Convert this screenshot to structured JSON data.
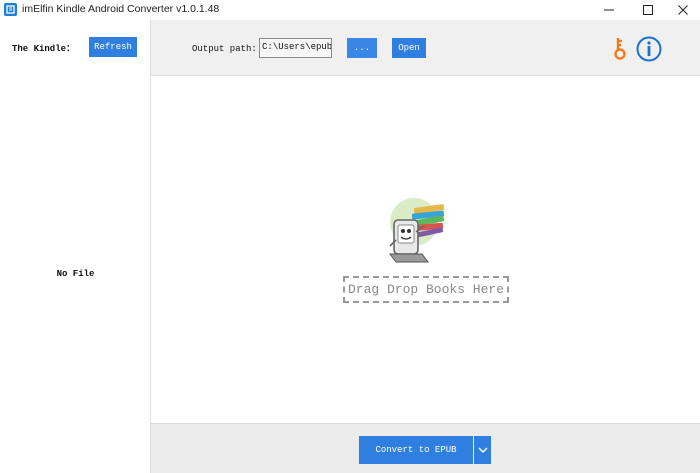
{
  "window": {
    "title": "imElfin Kindle Android Converter v1.0.1.48"
  },
  "left_panel": {
    "kindle_label": "The Kindle：",
    "refresh_label": "Refresh",
    "empty_text": "No File"
  },
  "toolbar": {
    "output_label": "Output path:",
    "output_path_value": "C:\\Users\\epubo\\",
    "browse_label": "...",
    "open_label": "Open"
  },
  "drop_area": {
    "hint": "Drag Drop Books Here"
  },
  "bottom_bar": {
    "convert_label": "Convert to EPUB"
  },
  "icons": {
    "app": "app-icon",
    "minimize": "minimize-icon",
    "maximize": "maximize-icon",
    "close": "close-icon",
    "key": "key-icon",
    "info": "info-icon",
    "dropdown": "chevron-down-icon"
  },
  "colors": {
    "accent": "#2f7fe0",
    "key_orange": "#f07a1a",
    "info_blue": "#1f6fd1"
  }
}
